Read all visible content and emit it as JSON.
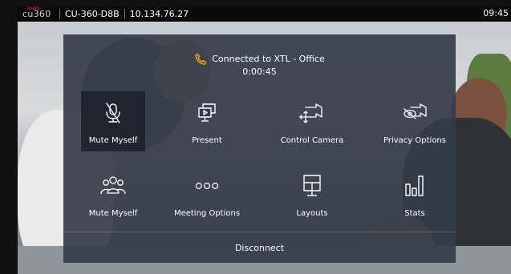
{
  "topbar": {
    "logo_brand": "AVAYA",
    "logo_text": "cu360",
    "device": "CU-360-D8B",
    "ip": "10.134.76.27",
    "time": "09:45"
  },
  "call": {
    "status": "Connected to XTL - Office",
    "duration": "0:00:45"
  },
  "menu": {
    "row1": [
      {
        "label": "Mute Myself",
        "icon": "mic-off-icon"
      },
      {
        "label": "Present",
        "icon": "present-icon"
      },
      {
        "label": "Control Camera",
        "icon": "control-camera-icon"
      },
      {
        "label": "Privacy Options",
        "icon": "camera-off-icon"
      }
    ],
    "row2": [
      {
        "label": "Mute Myself",
        "icon": "group-icon"
      },
      {
        "label": "Meeting Options",
        "icon": "more-icon"
      },
      {
        "label": "Layouts",
        "icon": "layouts-icon"
      },
      {
        "label": "Stats",
        "icon": "stats-icon"
      }
    ],
    "disconnect_label": "Disconnect"
  },
  "colors": {
    "panel": "#343c48",
    "accent_phone": "#f0a81c",
    "brand_red": "#e0182d"
  }
}
